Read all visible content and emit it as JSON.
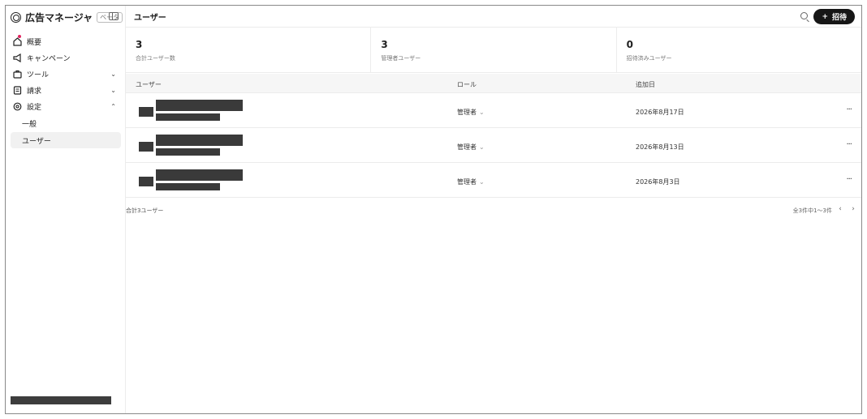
{
  "app": {
    "name": "広告マネージャ",
    "beta_label": "ベータ"
  },
  "sidebar": {
    "items": [
      {
        "label": "概要",
        "icon": "home-icon",
        "has_notification": true
      },
      {
        "label": "キャンペーン",
        "icon": "megaphone-icon"
      },
      {
        "label": "ツール",
        "icon": "toolbox-icon",
        "chevron": "⌄"
      },
      {
        "label": "請求",
        "icon": "billing-icon",
        "chevron": "⌄"
      },
      {
        "label": "設定",
        "icon": "gear-icon",
        "chevron": "⌃"
      }
    ],
    "settings_subitems": [
      {
        "label": "一般",
        "active": false
      },
      {
        "label": "ユーザー",
        "active": true
      }
    ]
  },
  "header": {
    "title": "ユーザー",
    "invite_button": "招待",
    "invite_plus": "+"
  },
  "stats": [
    {
      "value": "3",
      "label": "合計ユーザー数"
    },
    {
      "value": "3",
      "label": "管理者ユーザー"
    },
    {
      "value": "0",
      "label": "招待済みユーザー"
    }
  ],
  "table": {
    "headers": {
      "user": "ユーザー",
      "role": "ロール",
      "added": "追加日"
    },
    "rows": [
      {
        "role": "管理者",
        "added": "2026年8月17日"
      },
      {
        "role": "管理者",
        "added": "2026年8月13日"
      },
      {
        "role": "管理者",
        "added": "2026年8月3日"
      }
    ],
    "dropdown_glyph": "⌄",
    "more_glyph": "···"
  },
  "footer": {
    "total": "合計3ユーザー",
    "pagination": "全3件中1〜3件",
    "prev": "‹",
    "next": "›"
  },
  "colors": {
    "accent_button": "#161616",
    "redaction": "#3a3a3a",
    "notification_dot": "#e0245e"
  }
}
